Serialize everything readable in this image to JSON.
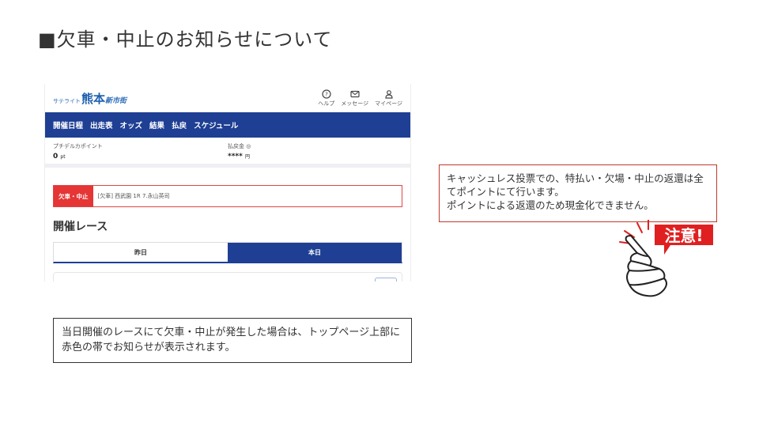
{
  "slide": {
    "title": "■欠車・中止のお知らせについて"
  },
  "app": {
    "logo": {
      "prefix": "サテライト",
      "main": "熊本",
      "suffix": "新市街"
    },
    "header_icons": [
      {
        "icon": "help-icon",
        "label": "ヘルプ"
      },
      {
        "icon": "mail-icon",
        "label": "メッセージ"
      },
      {
        "icon": "user-icon",
        "label": "マイページ"
      }
    ],
    "nav": [
      "開催日程",
      "出走表",
      "オッズ",
      "結果",
      "払戻",
      "スケジュール"
    ],
    "points": {
      "label": "プチデルカポイント",
      "value": "0",
      "unit": "pt"
    },
    "refund": {
      "label": "払戻金",
      "value": "****",
      "unit": "円"
    },
    "alert": {
      "tag": "欠車・中止",
      "text": "[欠車] 西武園 1R 7.永山英司"
    },
    "race_heading": "開催レース",
    "tabs": {
      "yesterday": "昨日",
      "today": "本日"
    }
  },
  "caption": "当日開催のレースにて欠車・中止が発生した場合は、トップページ上部に赤色の帯でお知らせが表示されます。",
  "note": {
    "line1": "キャッシュレス投票での、特払い・欠場・中止の返還は全てポイントにて行います。",
    "line2": "ポイントによる返還のため現金化できません。"
  },
  "caution": {
    "label": "注意!",
    "color": "#e02020"
  }
}
